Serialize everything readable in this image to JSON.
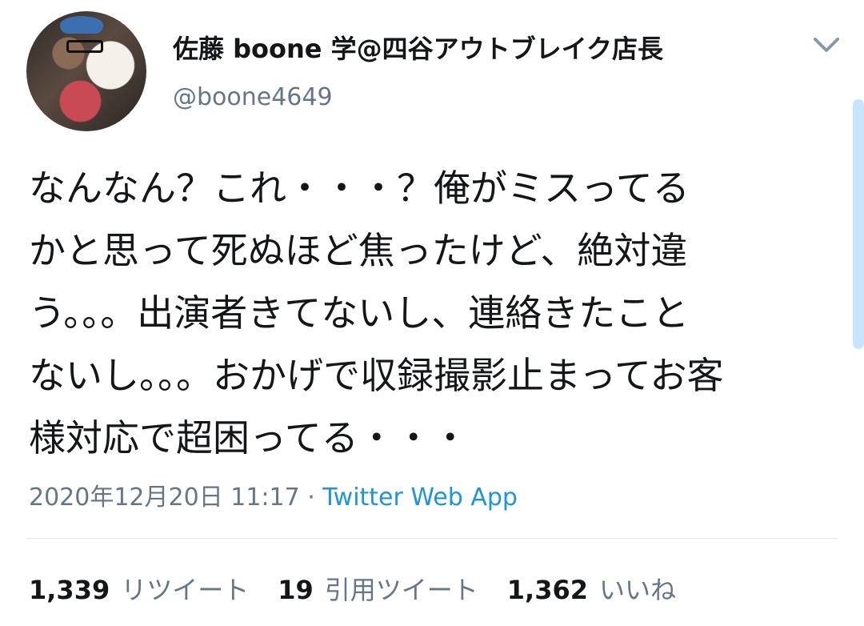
{
  "user": {
    "display_name": "佐藤 boone 学@四谷アウトブレイク店長",
    "handle": "@boone4649"
  },
  "tweet": {
    "lines": [
      "なんなん？これ・・・？俺がミスってる",
      "かと思って死ぬほど焦ったけど、絶対違",
      "う。。。出演者きてないし、連絡きたこと",
      "ないし。。。おかげで収録撮影止まってお客",
      "様対応で超困ってる・・・"
    ],
    "timestamp": "2020年12月20日 11:17",
    "separator": " · ",
    "source": "Twitter Web App"
  },
  "stats": {
    "retweets": {
      "count": "1,339",
      "label": "リツイート"
    },
    "quotes": {
      "count": "19",
      "label": "引用ツイート"
    },
    "likes": {
      "count": "1,362",
      "label": "いいね"
    }
  },
  "icons": {
    "menu": "chevron-down-icon"
  },
  "colors": {
    "text": "#14171a",
    "secondary": "#657786",
    "link": "#1b95e0",
    "divider": "#e1e8ed"
  }
}
